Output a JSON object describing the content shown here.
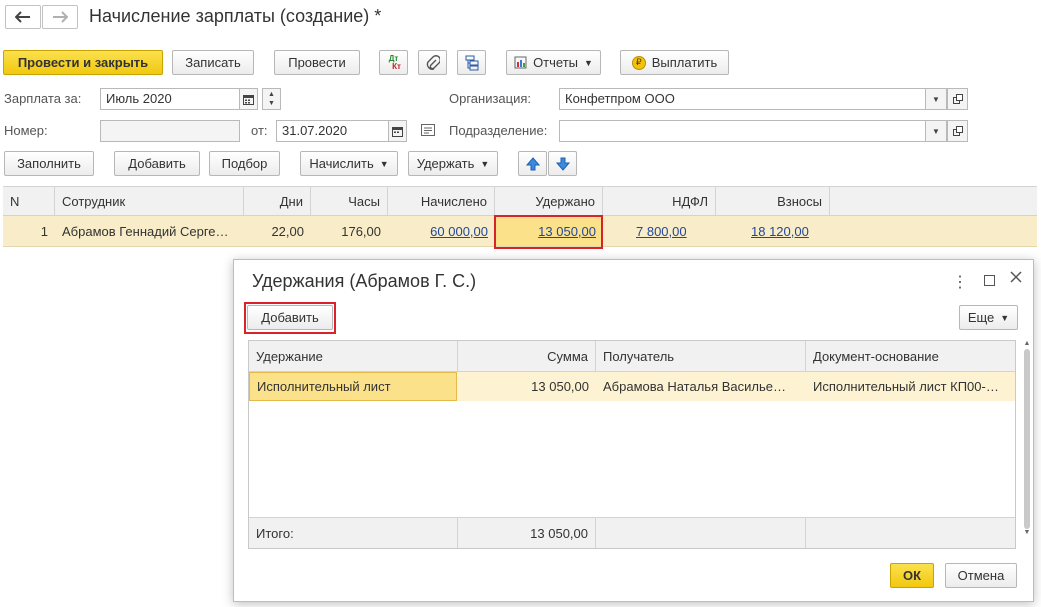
{
  "window": {
    "title": "Начисление зарплаты (создание) *"
  },
  "toolbar": {
    "post_close": "Провести и закрыть",
    "save": "Записать",
    "post": "Провести",
    "dtkt_dt": "Дт",
    "dtkt_kt": "Кт",
    "reports": "Отчеты",
    "pay": "Выплатить"
  },
  "form": {
    "salary_for_label": "Зарплата за:",
    "salary_for_value": "Июль 2020",
    "org_label": "Организация:",
    "org_value": "Конфетпром ООО",
    "number_label": "Номер:",
    "number_value": "",
    "from_label": "от:",
    "from_value": "31.07.2020",
    "division_label": "Подразделение:",
    "division_value": ""
  },
  "actions": {
    "fill": "Заполнить",
    "add": "Добавить",
    "select": "Подбор",
    "accrue": "Начислить",
    "deduct": "Удержать"
  },
  "main_table": {
    "columns": [
      "N",
      "Сотрудник",
      "Дни",
      "Часы",
      "Начислено",
      "Удержано",
      "НДФЛ",
      "Взносы"
    ],
    "rows": [
      {
        "n": "1",
        "employee": "Абрамов Геннадий Серге…",
        "days": "22,00",
        "hours": "176,00",
        "accrued": "60 000,00",
        "deducted": "13 050,00",
        "ndfl": "7 800,00",
        "contrib": "18 120,00"
      }
    ]
  },
  "modal": {
    "title": "Удержания (Абрамов Г. С.)",
    "add": "Добавить",
    "more": "Еще",
    "columns": [
      "Удержание",
      "Сумма",
      "Получатель",
      "Документ-основание"
    ],
    "rows": [
      {
        "deduction": "Исполнительный лист",
        "sum": "13 050,00",
        "recipient": "Абрамова Наталья Василье…",
        "basis": "Исполнительный лист КП00-…"
      }
    ],
    "total_label": "Итого:",
    "total_value": "13 050,00",
    "ok": "ОК",
    "cancel": "Отмена"
  },
  "colors": {
    "primary_button": "#f2c80f",
    "selected_row": "#f8edc8",
    "highlight_border": "#d9232a",
    "link": "#23479c"
  }
}
